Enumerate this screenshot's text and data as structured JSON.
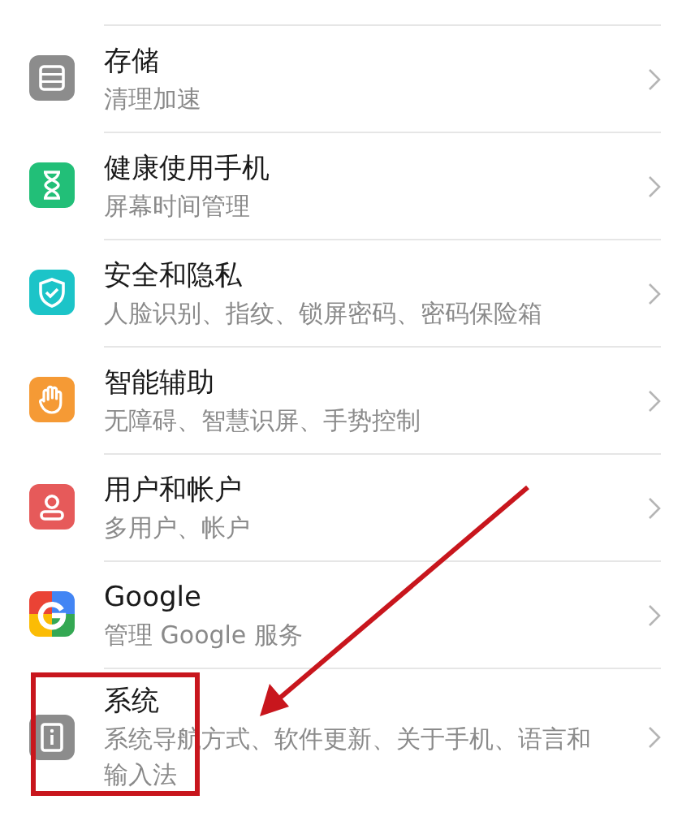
{
  "settings_items": [
    {
      "kind": "storage",
      "title": "存储",
      "subtitle": "清理加速",
      "highlighted": false
    },
    {
      "kind": "hourglass",
      "title": "健康使用手机",
      "subtitle": "屏幕时间管理",
      "highlighted": false
    },
    {
      "kind": "shield",
      "title": "安全和隐私",
      "subtitle": "人脸识别、指纹、锁屏密码、密码保险箱",
      "highlighted": false
    },
    {
      "kind": "hand",
      "title": "智能辅助",
      "subtitle": "无障碍、智慧识屏、手势控制",
      "highlighted": false
    },
    {
      "kind": "user",
      "title": "用户和帐户",
      "subtitle": "多用户、帐户",
      "highlighted": false
    },
    {
      "kind": "google",
      "title": "Google",
      "subtitle": "管理 Google 服务",
      "highlighted": false
    },
    {
      "kind": "info",
      "title": "系统",
      "subtitle": "系统导航方式、软件更新、关于手机、语言和输入法",
      "highlighted": true
    }
  ]
}
